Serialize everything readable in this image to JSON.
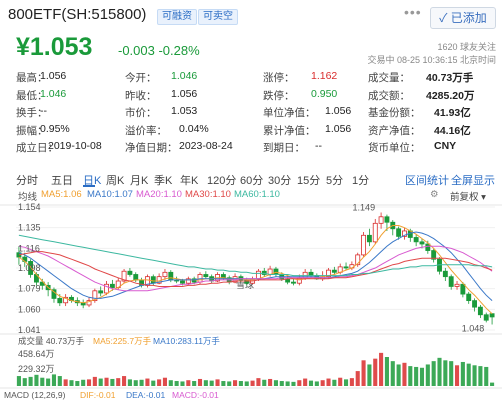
{
  "header": {
    "title": "800ETF(SH:515800)",
    "tag_margin": "可融资",
    "tag_short": "可卖空",
    "more": "•••",
    "added_button": "已添加",
    "price": "¥1.053",
    "change": "-0.003  -0.28%",
    "followers": "1620 球友关注",
    "trade_time": "交易中 08-25 10:36:15 北京时间"
  },
  "stats": [
    [
      {
        "label": "最高：",
        "value": "1.056"
      },
      {
        "label": "今开：",
        "value": "1.046",
        "color": "green"
      },
      {
        "label": "涨停：",
        "value": "1.162",
        "color": "red"
      },
      {
        "label": "成交量：",
        "value": "40.73万手"
      }
    ],
    [
      {
        "label": "最低：",
        "value": "1.046",
        "color": "green"
      },
      {
        "label": "昨收：",
        "value": "1.056"
      },
      {
        "label": "跌停：",
        "value": "0.950",
        "color": "green"
      },
      {
        "label": "成交额：",
        "value": "4285.20万"
      }
    ],
    [
      {
        "label": "换手：",
        "value": "--"
      },
      {
        "label": "市价：",
        "value": "1.053"
      },
      {
        "label": "单位净值：",
        "value": "1.056"
      },
      {
        "label": "基金份额：",
        "value": "41.93亿"
      }
    ],
    [
      {
        "label": "振幅：",
        "value": "0.95%"
      },
      {
        "label": "溢价率：",
        "value": "0.04%"
      },
      {
        "label": "累计净值：",
        "value": "1.056"
      },
      {
        "label": "资产净值：",
        "value": "44.16亿"
      }
    ],
    [
      {
        "label": "成立日：",
        "value": "2019-10-08"
      },
      {
        "label": "净值日期：",
        "value": "2023-08-24"
      },
      {
        "label": "到期日：",
        "value": "--"
      },
      {
        "label": "货币单位：",
        "value": "CNY"
      }
    ]
  ],
  "tabs": {
    "items": [
      "分时",
      "五日",
      "日K",
      "周K",
      "月K",
      "季K",
      "年K",
      "120分",
      "60分",
      "30分",
      "15分",
      "5分",
      "1分"
    ],
    "active": "日K",
    "interval_stats": "区间统计",
    "fullscreen": "全屏显示"
  },
  "toolbar": {
    "label": "均线",
    "ma5": "MA5:1.06",
    "ma10": "MA10:1.07",
    "ma20": "MA20:1.10",
    "ma30": "MA30:1.10",
    "ma60": "MA60:1.10",
    "adjust": "前复权"
  },
  "axis": {
    "price_ticks": [
      "1.154",
      "1.135",
      "1.116",
      "1.098",
      "1.079",
      "1.060",
      "1.041"
    ],
    "high_marker": "1.149",
    "low_marker": "1.048",
    "volume_ticks": [
      "458.64万",
      "229.32万"
    ]
  },
  "volume_bar": {
    "label": "成交量 40.73万手",
    "ma5": "MA5:225.7万手",
    "ma10": "MA10:283.11万手"
  },
  "macd_bar": {
    "label": "MACD (12,26,9)",
    "dif": "DIF:-0.01",
    "dea": "DEA:-0.01",
    "macd": "MACD:-0.01"
  },
  "watermark": "雪球",
  "colors": {
    "up": "#d92c2c",
    "down": "#1a9a3a",
    "accent": "#2a6cc4",
    "ma5": "#f0a030",
    "ma10": "#3a78c8",
    "ma20": "#d85ad0",
    "ma30": "#e04848",
    "ma60": "#3cb8a0"
  },
  "chart_data": {
    "type": "candlestick",
    "ylim": [
      1.041,
      1.154
    ],
    "candles": [
      [
        1.112,
        1.108,
        1.118,
        1.101
      ],
      [
        1.108,
        1.104,
        1.112,
        1.099
      ],
      [
        1.104,
        1.092,
        1.106,
        1.089
      ],
      [
        1.092,
        1.085,
        1.094,
        1.082
      ],
      [
        1.085,
        1.082,
        1.088,
        1.078
      ],
      [
        1.082,
        1.078,
        1.085,
        1.072
      ],
      [
        1.078,
        1.07,
        1.08,
        1.066
      ],
      [
        1.07,
        1.066,
        1.074,
        1.063
      ],
      [
        1.066,
        1.071,
        1.074,
        1.063
      ],
      [
        1.071,
        1.068,
        1.073,
        1.066
      ],
      [
        1.068,
        1.066,
        1.071,
        1.063
      ],
      [
        1.066,
        1.064,
        1.069,
        1.061
      ],
      [
        1.064,
        1.068,
        1.071,
        1.062
      ],
      [
        1.068,
        1.077,
        1.079,
        1.066
      ],
      [
        1.077,
        1.075,
        1.081,
        1.072
      ],
      [
        1.075,
        1.083,
        1.086,
        1.073
      ],
      [
        1.083,
        1.08,
        1.087,
        1.077
      ],
      [
        1.08,
        1.086,
        1.089,
        1.078
      ],
      [
        1.086,
        1.095,
        1.097,
        1.084
      ],
      [
        1.095,
        1.092,
        1.098,
        1.09
      ],
      [
        1.092,
        1.087,
        1.094,
        1.085
      ],
      [
        1.087,
        1.082,
        1.089,
        1.08
      ],
      [
        1.082,
        1.09,
        1.092,
        1.08
      ],
      [
        1.09,
        1.084,
        1.092,
        1.082
      ],
      [
        1.084,
        1.09,
        1.093,
        1.083
      ],
      [
        1.09,
        1.094,
        1.097,
        1.087
      ],
      [
        1.094,
        1.087,
        1.096,
        1.085
      ],
      [
        1.087,
        1.086,
        1.09,
        1.084
      ],
      [
        1.086,
        1.084,
        1.088,
        1.082
      ],
      [
        1.084,
        1.088,
        1.09,
        1.082
      ],
      [
        1.088,
        1.085,
        1.09,
        1.083
      ],
      [
        1.085,
        1.092,
        1.094,
        1.083
      ],
      [
        1.092,
        1.09,
        1.095,
        1.088
      ],
      [
        1.09,
        1.086,
        1.092,
        1.084
      ],
      [
        1.086,
        1.092,
        1.094,
        1.085
      ],
      [
        1.092,
        1.089,
        1.094,
        1.087
      ],
      [
        1.089,
        1.085,
        1.091,
        1.083
      ],
      [
        1.085,
        1.09,
        1.093,
        1.084
      ],
      [
        1.09,
        1.087,
        1.092,
        1.085
      ],
      [
        1.087,
        1.084,
        1.089,
        1.082
      ],
      [
        1.084,
        1.088,
        1.09,
        1.083
      ],
      [
        1.088,
        1.095,
        1.097,
        1.086
      ],
      [
        1.095,
        1.092,
        1.098,
        1.09
      ],
      [
        1.092,
        1.097,
        1.1,
        1.09
      ],
      [
        1.097,
        1.092,
        1.099,
        1.09
      ],
      [
        1.092,
        1.088,
        1.094,
        1.086
      ],
      [
        1.088,
        1.085,
        1.091,
        1.083
      ],
      [
        1.085,
        1.084,
        1.088,
        1.082
      ],
      [
        1.084,
        1.089,
        1.092,
        1.082
      ],
      [
        1.089,
        1.094,
        1.097,
        1.087
      ],
      [
        1.094,
        1.091,
        1.097,
        1.089
      ],
      [
        1.091,
        1.088,
        1.093,
        1.087
      ],
      [
        1.088,
        1.09,
        1.095,
        1.086
      ],
      [
        1.09,
        1.096,
        1.098,
        1.088
      ],
      [
        1.096,
        1.094,
        1.099,
        1.092
      ],
      [
        1.094,
        1.099,
        1.102,
        1.092
      ],
      [
        1.099,
        1.098,
        1.103,
        1.096
      ],
      [
        1.098,
        1.101,
        1.104,
        1.096
      ],
      [
        1.101,
        1.11,
        1.112,
        1.099
      ],
      [
        1.11,
        1.128,
        1.131,
        1.108
      ],
      [
        1.128,
        1.122,
        1.134,
        1.118
      ],
      [
        1.122,
        1.139,
        1.143,
        1.12
      ],
      [
        1.139,
        1.145,
        1.149,
        1.134
      ],
      [
        1.145,
        1.14,
        1.147,
        1.132
      ],
      [
        1.14,
        1.134,
        1.142,
        1.128
      ],
      [
        1.134,
        1.127,
        1.136,
        1.124
      ],
      [
        1.127,
        1.132,
        1.135,
        1.124
      ],
      [
        1.132,
        1.126,
        1.134,
        1.122
      ],
      [
        1.126,
        1.122,
        1.129,
        1.118
      ],
      [
        1.122,
        1.12,
        1.125,
        1.116
      ],
      [
        1.12,
        1.114,
        1.123,
        1.111
      ],
      [
        1.114,
        1.106,
        1.116,
        1.103
      ],
      [
        1.106,
        1.095,
        1.108,
        1.092
      ],
      [
        1.095,
        1.09,
        1.098,
        1.086
      ],
      [
        1.09,
        1.081,
        1.092,
        1.078
      ],
      [
        1.081,
        1.083,
        1.086,
        1.078
      ],
      [
        1.083,
        1.074,
        1.085,
        1.071
      ],
      [
        1.074,
        1.068,
        1.076,
        1.065
      ],
      [
        1.068,
        1.062,
        1.07,
        1.058
      ],
      [
        1.062,
        1.055,
        1.064,
        1.052
      ],
      [
        1.055,
        1.05,
        1.057,
        1.048
      ],
      [
        1.056,
        1.053,
        1.056,
        1.046
      ]
    ],
    "ma_lines": {
      "ma5": [
        1.108,
        1.104,
        1.099,
        1.092,
        1.086,
        1.08,
        1.076,
        1.072,
        1.07,
        1.068,
        1.067,
        1.066,
        1.067,
        1.069,
        1.071,
        1.074,
        1.078,
        1.08,
        1.084,
        1.086,
        1.087,
        1.087,
        1.087,
        1.086,
        1.086,
        1.088,
        1.089,
        1.088,
        1.087,
        1.087,
        1.087,
        1.087,
        1.088,
        1.088,
        1.089,
        1.089,
        1.088,
        1.088,
        1.088,
        1.087,
        1.087,
        1.088,
        1.09,
        1.092,
        1.094,
        1.093,
        1.091,
        1.088,
        1.087,
        1.088,
        1.089,
        1.089,
        1.09,
        1.091,
        1.092,
        1.094,
        1.096,
        1.098,
        1.102,
        1.108,
        1.113,
        1.12,
        1.128,
        1.134,
        1.137,
        1.137,
        1.135,
        1.132,
        1.129,
        1.125,
        1.121,
        1.116,
        1.11,
        1.103,
        1.096,
        1.09,
        1.084,
        1.078,
        1.073,
        1.067,
        1.061,
        1.056
      ],
      "ma10": [
        1.112,
        1.11,
        1.107,
        1.103,
        1.099,
        1.095,
        1.091,
        1.087,
        1.083,
        1.079,
        1.076,
        1.073,
        1.071,
        1.07,
        1.07,
        1.071,
        1.072,
        1.074,
        1.076,
        1.078,
        1.08,
        1.082,
        1.083,
        1.084,
        1.085,
        1.086,
        1.087,
        1.087,
        1.087,
        1.087,
        1.087,
        1.088,
        1.088,
        1.088,
        1.088,
        1.088,
        1.088,
        1.088,
        1.088,
        1.088,
        1.088,
        1.088,
        1.088,
        1.089,
        1.09,
        1.09,
        1.09,
        1.09,
        1.09,
        1.09,
        1.09,
        1.09,
        1.089,
        1.089,
        1.09,
        1.091,
        1.092,
        1.093,
        1.095,
        1.099,
        1.103,
        1.108,
        1.113,
        1.118,
        1.122,
        1.125,
        1.128,
        1.13,
        1.131,
        1.13,
        1.128,
        1.125,
        1.121,
        1.117,
        1.112,
        1.106,
        1.1,
        1.093,
        1.086,
        1.079,
        1.073,
        1.068
      ],
      "ma20": [
        1.118,
        1.117,
        1.115,
        1.113,
        1.111,
        1.109,
        1.106,
        1.103,
        1.1,
        1.097,
        1.094,
        1.091,
        1.088,
        1.085,
        1.083,
        1.081,
        1.079,
        1.078,
        1.077,
        1.077,
        1.077,
        1.077,
        1.077,
        1.078,
        1.079,
        1.08,
        1.081,
        1.082,
        1.083,
        1.083,
        1.084,
        1.085,
        1.086,
        1.086,
        1.087,
        1.087,
        1.087,
        1.087,
        1.088,
        1.088,
        1.088,
        1.088,
        1.088,
        1.088,
        1.088,
        1.089,
        1.089,
        1.089,
        1.089,
        1.089,
        1.089,
        1.089,
        1.089,
        1.089,
        1.089,
        1.09,
        1.09,
        1.091,
        1.092,
        1.094,
        1.096,
        1.098,
        1.101,
        1.104,
        1.107,
        1.11,
        1.112,
        1.114,
        1.116,
        1.117,
        1.118,
        1.118,
        1.118,
        1.117,
        1.116,
        1.114,
        1.112,
        1.109,
        1.106,
        1.103,
        1.099,
        1.095
      ],
      "ma30": [
        1.11,
        1.111,
        1.112,
        1.113,
        1.113,
        1.112,
        1.111,
        1.11,
        1.108,
        1.106,
        1.104,
        1.102,
        1.1,
        1.097,
        1.095,
        1.093,
        1.091,
        1.089,
        1.087,
        1.086,
        1.084,
        1.083,
        1.082,
        1.082,
        1.081,
        1.081,
        1.081,
        1.081,
        1.081,
        1.082,
        1.082,
        1.083,
        1.083,
        1.084,
        1.084,
        1.085,
        1.085,
        1.086,
        1.086,
        1.086,
        1.086,
        1.087,
        1.087,
        1.087,
        1.087,
        1.087,
        1.088,
        1.088,
        1.088,
        1.088,
        1.088,
        1.088,
        1.088,
        1.088,
        1.089,
        1.089,
        1.089,
        1.09,
        1.091,
        1.092,
        1.093,
        1.095,
        1.097,
        1.099,
        1.101,
        1.102,
        1.104,
        1.105,
        1.106,
        1.107,
        1.107,
        1.107,
        1.107,
        1.107,
        1.106,
        1.105,
        1.104,
        1.103,
        1.101,
        1.1,
        1.098,
        1.096
      ],
      "ma60": [
        1.128,
        1.127,
        1.126,
        1.125,
        1.124,
        1.123,
        1.122,
        1.121,
        1.12,
        1.119,
        1.118,
        1.117,
        1.116,
        1.115,
        1.114,
        1.113,
        1.112,
        1.111,
        1.11,
        1.109,
        1.108,
        1.107,
        1.106,
        1.105,
        1.104,
        1.103,
        1.102,
        1.101,
        1.1,
        1.099,
        1.099,
        1.098,
        1.097,
        1.097,
        1.096,
        1.096,
        1.095,
        1.095,
        1.094,
        1.094,
        1.093,
        1.093,
        1.093,
        1.092,
        1.092,
        1.092,
        1.092,
        1.091,
        1.091,
        1.091,
        1.091,
        1.091,
        1.091,
        1.091,
        1.091,
        1.091,
        1.091,
        1.092,
        1.092,
        1.093,
        1.093,
        1.094,
        1.095,
        1.096,
        1.097,
        1.097,
        1.098,
        1.099,
        1.099,
        1.1,
        1.1,
        1.1,
        1.101,
        1.101,
        1.101,
        1.101,
        1.101,
        1.101,
        1.1,
        1.1,
        1.1,
        1.099
      ]
    },
    "volume_ylim": [
      0,
      458.64
    ],
    "volumes": [
      120,
      95,
      110,
      135,
      100,
      90,
      140,
      120,
      80,
      70,
      60,
      75,
      80,
      110,
      90,
      100,
      85,
      95,
      120,
      80,
      70,
      75,
      90,
      65,
      80,
      100,
      70,
      60,
      55,
      70,
      60,
      85,
      70,
      65,
      80,
      60,
      55,
      70,
      60,
      55,
      65,
      95,
      75,
      85,
      70,
      60,
      55,
      50,
      70,
      90,
      65,
      55,
      70,
      90,
      75,
      100,
      80,
      95,
      180,
      310,
      260,
      330,
      400,
      350,
      300,
      260,
      280,
      240,
      230,
      220,
      260,
      300,
      340,
      310,
      300,
      250,
      290,
      270,
      250,
      240,
      230,
      41
    ],
    "macd": [
      0.2,
      0.1,
      -0.2,
      -0.5,
      -0.7,
      -0.9,
      -1.1,
      -1.2,
      -1.1,
      -1.0,
      -0.9,
      -0.8,
      -0.6,
      -0.4,
      -0.2,
      0.0,
      0.2,
      0.3,
      0.5,
      0.6,
      0.5,
      0.4,
      0.4,
      0.3,
      0.3,
      0.4,
      0.3,
      0.2,
      0.1,
      0.1,
      0.1,
      0.2,
      0.2,
      0.1,
      0.2,
      0.1,
      0.0,
      0.1,
      0.0,
      -0.1,
      0.0,
      0.2,
      0.3,
      0.4,
      0.3,
      0.2,
      0.0,
      -0.1,
      0.0,
      0.2,
      0.2,
      0.1,
      0.1,
      0.3,
      0.3,
      0.4,
      0.4,
      0.5,
      0.8,
      1.3,
      1.4,
      1.7,
      1.9,
      1.7,
      1.4,
      1.0,
      0.9,
      0.6,
      0.3,
      0.0,
      -0.3,
      -0.6,
      -1.0,
      -1.3,
      -1.6,
      -1.6,
      -1.8,
      -1.9,
      -2.0,
      -2.0,
      -1.9,
      -1.8
    ]
  }
}
